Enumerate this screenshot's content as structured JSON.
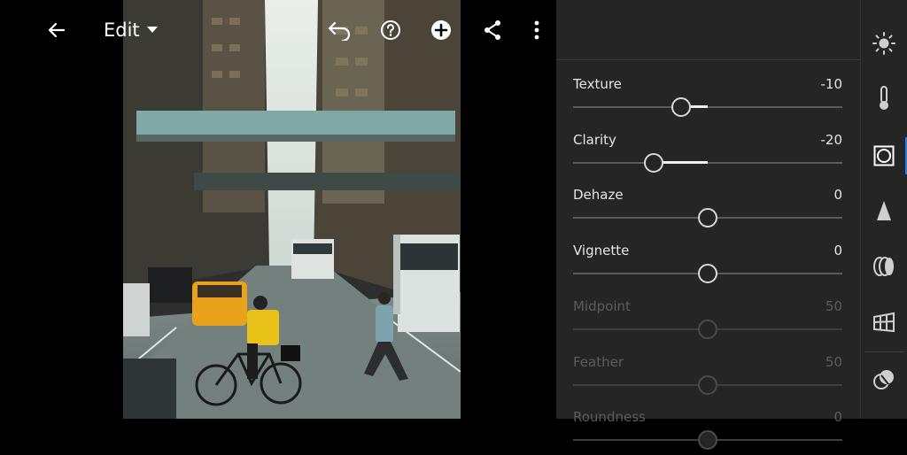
{
  "toolbar": {
    "edit_label": "Edit"
  },
  "sliders": [
    {
      "label": "Texture",
      "value": "-10",
      "level": -0.1,
      "disabled": false
    },
    {
      "label": "Clarity",
      "value": "-20",
      "level": -0.2,
      "disabled": false
    },
    {
      "label": "Dehaze",
      "value": "0",
      "level": 0,
      "disabled": false
    },
    {
      "label": "Vignette",
      "value": "0",
      "level": 0,
      "disabled": false
    },
    {
      "label": "Midpoint",
      "value": "50",
      "level": 0,
      "disabled": true
    },
    {
      "label": "Feather",
      "value": "50",
      "level": 0,
      "disabled": true
    },
    {
      "label": "Roundness",
      "value": "0",
      "level": 0,
      "disabled": true
    }
  ],
  "tools": [
    "light-icon",
    "color-icon",
    "effects-icon",
    "detail-icon",
    "optics-icon",
    "geometry-icon",
    "presets-icon"
  ],
  "colors": {
    "panel": "#252525",
    "accent": "#2d7be5",
    "taxi": "#e9a21a"
  }
}
